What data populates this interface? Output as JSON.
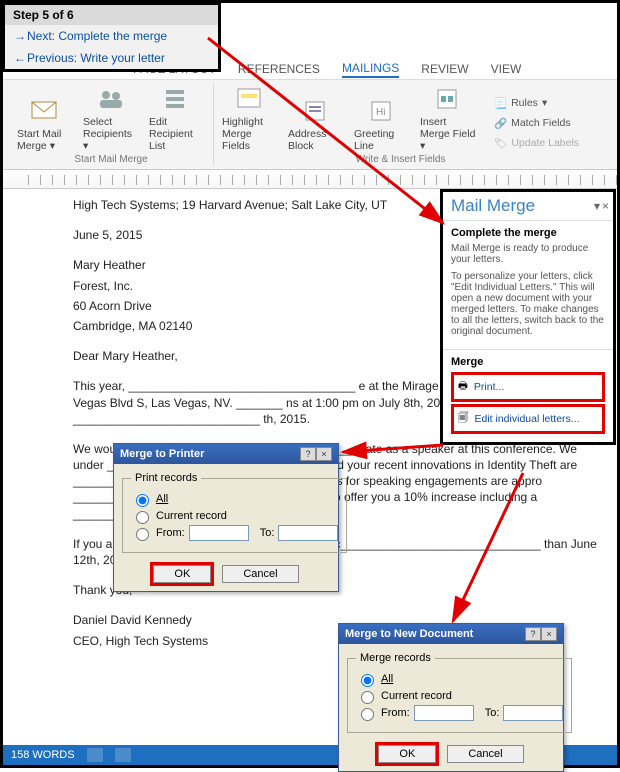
{
  "step": {
    "title": "Step 5 of 6",
    "next": "Next: Complete the merge",
    "prev": "Previous: Write your letter"
  },
  "tabs": {
    "pagelayout": "PAGE LAYOUT",
    "references": "REFERENCES",
    "mailings": "MAILINGS",
    "review": "REVIEW",
    "view": "VIEW"
  },
  "ribbon": {
    "startmail": "Start Mail Merge",
    "startmail_dd": "▾",
    "select": "Select Recipients",
    "select_dd": "▾",
    "edit": "Edit Recipient List",
    "group1": "Start Mail Merge",
    "highlight": "Highlight Merge Fields",
    "address": "Address Block",
    "greeting": "Greeting Line",
    "insertfield": "Insert Merge Field",
    "insertfield_dd": "▾",
    "group2": "Write & Insert Fields",
    "rules": "Rules",
    "rules_dd": "▾",
    "match": "Match Fields",
    "update": "Update Labels"
  },
  "doc": {
    "header": "High Tech Systems; 19 Harvard Avenue; Salt Lake City, UT",
    "date": "June 5, 2015",
    "addr1": "Mary Heather",
    "addr2": "Forest, Inc.",
    "addr3": "60 Acorn Drive",
    "addr4": "Cambridge, MA 02140",
    "salut": "Dear Mary Heather,",
    "p1": "This year, __________________________________ e at the Mirage Hotel, located at 3400 Las Vegas Blvd S, Las Vegas, NV. _______ ns at 1:00 pm on July 8th, 2015 and continue ____________________________ th, 2015.",
    "p2": "We would __________________________________ pate as a speaker at this conference. We under __________________________________ d your recent innovations in Identity Theft are __________________________________ lar fees for speaking engagements are appro __________________________________ ared to offer you a 10% increase including a __________.",
    "p3": "If you are interested in participating, please contac______________________________ than June 12th, 2015. Her contact information is lis_______",
    "thanks": "Thank you,",
    "sig1": "Daniel David Kennedy",
    "sig2": "CEO, High Tech Systems"
  },
  "pane": {
    "title": "Mail Merge",
    "task_dd": "▾",
    "close": "×",
    "sec1_h": "Complete the merge",
    "sec1_t1": "Mail Merge is ready to produce your letters.",
    "sec1_t2": "To personalize your letters, click \"Edit Individual Letters.\" This will open a new document with your merged letters. To make changes to all the letters, switch back to the original document.",
    "sec2_h": "Merge",
    "print": "Print...",
    "edit": "Edit individual letters..."
  },
  "dlg_print": {
    "title": "Merge to Printer",
    "group": "Print records",
    "all": "All",
    "current": "Current record",
    "from": "From:",
    "to": "To:",
    "ok": "OK",
    "cancel": "Cancel"
  },
  "dlg_new": {
    "title": "Merge to New Document",
    "group": "Merge records",
    "all": "All",
    "current": "Current record",
    "from": "From:",
    "to": "To:",
    "ok": "OK",
    "cancel": "Cancel"
  },
  "status": {
    "words": "158 WORDS"
  }
}
